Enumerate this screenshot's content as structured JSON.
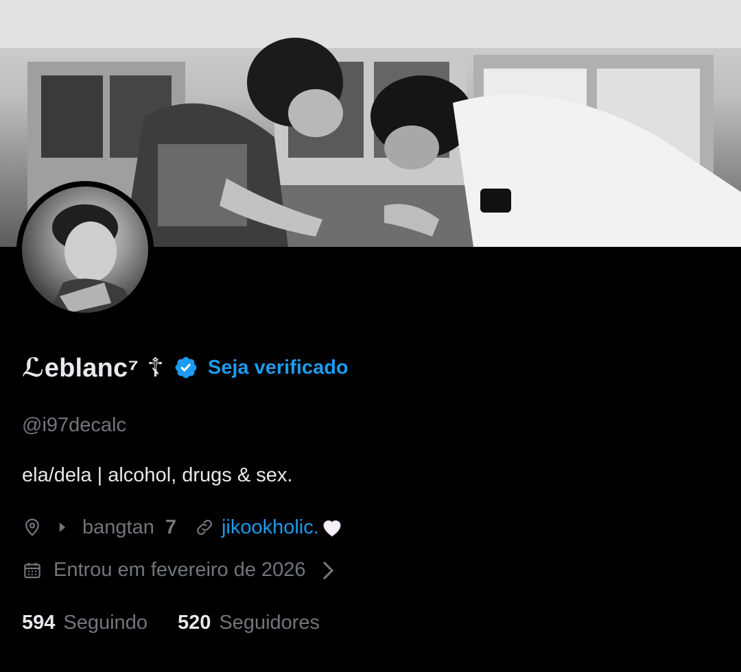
{
  "profile": {
    "display_name": "ℒeblanc⁷",
    "name_glyph": "☦",
    "verify_label": "Seja verificado",
    "handle": "@i97decalc",
    "bio": "ela/dela | alcohol, drugs & sex.",
    "location_text": "bangtan",
    "location_suffix": "7",
    "website": "jikookholic.",
    "joined": "Entrou em fevereiro de 2026"
  },
  "stats": {
    "following_count": "594",
    "following_label": "Seguindo",
    "followers_count": "520",
    "followers_label": "Seguidores"
  },
  "icons": {
    "verified": "verified-badge-icon",
    "location": "location-pin-icon",
    "link": "link-icon",
    "calendar": "calendar-icon",
    "heart": "white-heart-icon",
    "chevron": "chevron-right-icon"
  },
  "colors": {
    "background": "#000000",
    "primary_text": "#e7e9ea",
    "secondary_text": "#71767b",
    "accent": "#1d9bf0"
  }
}
